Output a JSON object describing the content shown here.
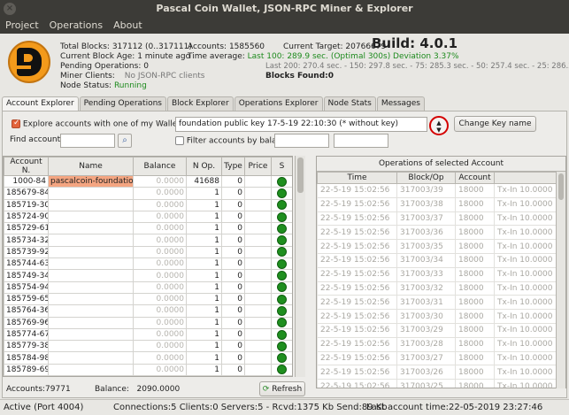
{
  "window": {
    "title": "Pascal Coin Wallet, JSON-RPC Miner & Explorer"
  },
  "menu": [
    "Project",
    "Operations",
    "About"
  ],
  "info": {
    "total_blocks_label": "Total Blocks:",
    "total_blocks": "317112 (0..317111)",
    "current_block_age_label": "Current Block Age:",
    "current_block_age": "1 minute ago",
    "pending_ops_label": "Pending Operations:",
    "pending_ops": "0",
    "miner_clients_label": "Miner Clients:",
    "miner_clients": "No JSON-RPC clients",
    "node_status_label": "Node Status:",
    "node_status": "Running",
    "accounts_label": "Accounts:",
    "accounts": "1585560",
    "time_average_label": "Time average:",
    "time_average": "Last 100: 289.9 sec. (Optimal 300s) Deviation 3.37%",
    "time_average_detail": "Last 200: 270.4 sec. - 150: 297.8 sec. - 75: 285.3 sec. - 50: 257.4 sec. - 25: 286.2 sec.",
    "current_target_label": "Current Target:",
    "current_target": "20766679",
    "build": "Build: 4.0.1",
    "blocks_found": "Blocks Found:0"
  },
  "tabs": [
    "Account Explorer",
    "Pending Operations",
    "Block Explorer",
    "Operations Explorer",
    "Node Stats",
    "Messages"
  ],
  "explorer": {
    "explore_label": "Explore accounts with one of my Wallet",
    "wallet_key": "foundation public key 17-5-19 22:10:30 (* without key)",
    "change_key_label": "Change Key name",
    "find_account_label": "Find account",
    "find_account_value": "",
    "filter_label": "Filter accounts by bala",
    "filter_min": "",
    "filter_max": ""
  },
  "accounts_table": {
    "headers": [
      "Account N.",
      "Name",
      "Balance",
      "N Op.",
      "Type",
      "Price",
      "S"
    ],
    "rows": [
      {
        "account": "1000-84",
        "name": "pascalcoin-foundation",
        "balance": "0.0000",
        "nop": "41688",
        "type": "0",
        "price": ""
      },
      {
        "account": "185679-84",
        "name": "",
        "balance": "0.0000",
        "nop": "1",
        "type": "0",
        "price": ""
      },
      {
        "account": "185719-30",
        "name": "",
        "balance": "0.0000",
        "nop": "1",
        "type": "0",
        "price": ""
      },
      {
        "account": "185724-90",
        "name": "",
        "balance": "0.0000",
        "nop": "1",
        "type": "0",
        "price": ""
      },
      {
        "account": "185729-61",
        "name": "",
        "balance": "0.0000",
        "nop": "1",
        "type": "0",
        "price": ""
      },
      {
        "account": "185734-32",
        "name": "",
        "balance": "0.0000",
        "nop": "1",
        "type": "0",
        "price": ""
      },
      {
        "account": "185739-92",
        "name": "",
        "balance": "0.0000",
        "nop": "1",
        "type": "0",
        "price": ""
      },
      {
        "account": "185744-63",
        "name": "",
        "balance": "0.0000",
        "nop": "1",
        "type": "0",
        "price": ""
      },
      {
        "account": "185749-34",
        "name": "",
        "balance": "0.0000",
        "nop": "1",
        "type": "0",
        "price": ""
      },
      {
        "account": "185754-94",
        "name": "",
        "balance": "0.0000",
        "nop": "1",
        "type": "0",
        "price": ""
      },
      {
        "account": "185759-65",
        "name": "",
        "balance": "0.0000",
        "nop": "1",
        "type": "0",
        "price": ""
      },
      {
        "account": "185764-36",
        "name": "",
        "balance": "0.0000",
        "nop": "1",
        "type": "0",
        "price": ""
      },
      {
        "account": "185769-96",
        "name": "",
        "balance": "0.0000",
        "nop": "1",
        "type": "0",
        "price": ""
      },
      {
        "account": "185774-67",
        "name": "",
        "balance": "0.0000",
        "nop": "1",
        "type": "0",
        "price": ""
      },
      {
        "account": "185779-38",
        "name": "",
        "balance": "0.0000",
        "nop": "1",
        "type": "0",
        "price": ""
      },
      {
        "account": "185784-98",
        "name": "",
        "balance": "0.0000",
        "nop": "1",
        "type": "0",
        "price": ""
      },
      {
        "account": "185789-69",
        "name": "",
        "balance": "0.0000",
        "nop": "1",
        "type": "0",
        "price": ""
      },
      {
        "account": "185794-40",
        "name": "",
        "balance": "0.0000",
        "nop": "1",
        "type": "0",
        "price": ""
      }
    ]
  },
  "summary": {
    "accounts_count": "Accounts:79771",
    "balance_label": "Balance:",
    "balance": "2090.0000",
    "refresh_label": "Refresh"
  },
  "ops_table": {
    "title": "Operations of selected Account",
    "headers": [
      "Time",
      "Block/Op",
      "Account",
      ""
    ],
    "rows": [
      {
        "time": "22-5-19 15:02:56",
        "block": "317003/39",
        "account": "18000",
        "desc": "Tx-In 10.0000 PA"
      },
      {
        "time": "22-5-19 15:02:56",
        "block": "317003/38",
        "account": "18000",
        "desc": "Tx-In 10.0000 PA"
      },
      {
        "time": "22-5-19 15:02:56",
        "block": "317003/37",
        "account": "18000",
        "desc": "Tx-In 10.0000 PA"
      },
      {
        "time": "22-5-19 15:02:56",
        "block": "317003/36",
        "account": "18000",
        "desc": "Tx-In 10.0000 PA"
      },
      {
        "time": "22-5-19 15:02:56",
        "block": "317003/35",
        "account": "18000",
        "desc": "Tx-In 10.0000 PA"
      },
      {
        "time": "22-5-19 15:02:56",
        "block": "317003/34",
        "account": "18000",
        "desc": "Tx-In 10.0000 PA"
      },
      {
        "time": "22-5-19 15:02:56",
        "block": "317003/33",
        "account": "18000",
        "desc": "Tx-In 10.0000 PA"
      },
      {
        "time": "22-5-19 15:02:56",
        "block": "317003/32",
        "account": "18000",
        "desc": "Tx-In 10.0000 PA"
      },
      {
        "time": "22-5-19 15:02:56",
        "block": "317003/31",
        "account": "18000",
        "desc": "Tx-In 10.0000 PA"
      },
      {
        "time": "22-5-19 15:02:56",
        "block": "317003/30",
        "account": "18000",
        "desc": "Tx-In 10.0000 PA"
      },
      {
        "time": "22-5-19 15:02:56",
        "block": "317003/29",
        "account": "18000",
        "desc": "Tx-In 10.0000 PA"
      },
      {
        "time": "22-5-19 15:02:56",
        "block": "317003/28",
        "account": "18000",
        "desc": "Tx-In 10.0000 PA"
      },
      {
        "time": "22-5-19 15:02:56",
        "block": "317003/27",
        "account": "18000",
        "desc": "Tx-In 10.0000 PA"
      },
      {
        "time": "22-5-19 15:02:56",
        "block": "317003/26",
        "account": "18000",
        "desc": "Tx-In 10.0000 PA"
      },
      {
        "time": "22-5-19 15:02:56",
        "block": "317003/25",
        "account": "18000",
        "desc": "Tx-In 10.0000 PA"
      }
    ]
  },
  "status": {
    "left": "Active (Port 4004)",
    "connections": "Connections:5 Clients:0 Servers:5 - Rcvd:1375 Kb Send:89 Kb",
    "last_account_time": "Last account time:22-05-2019 23:27:46"
  },
  "colors": {
    "accent": "#e3643c",
    "selected_name": "#f4a581",
    "status_ok": "#1f8f1f",
    "highlight_ring": "#d40000"
  }
}
